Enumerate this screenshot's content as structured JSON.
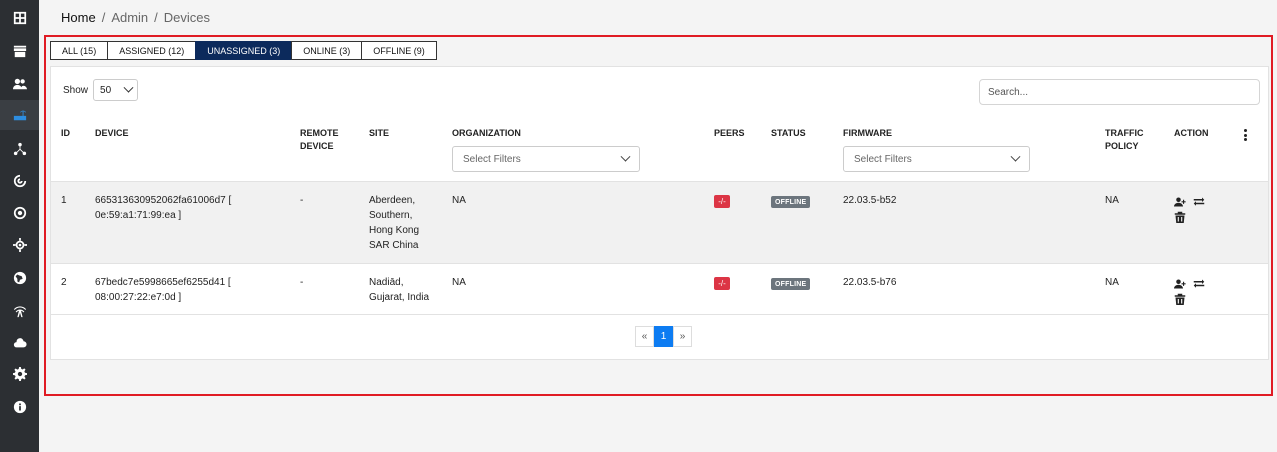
{
  "sidebar": {
    "items": [
      {
        "icon": "dashboard-icon"
      },
      {
        "icon": "store-icon"
      },
      {
        "icon": "users-icon"
      },
      {
        "icon": "router-icon",
        "active": true
      },
      {
        "icon": "network-icon"
      },
      {
        "icon": "radar-icon"
      },
      {
        "icon": "target-icon"
      },
      {
        "icon": "crosshair-icon"
      },
      {
        "icon": "globe-icon"
      },
      {
        "icon": "antenna-icon"
      },
      {
        "icon": "cloud-icon"
      },
      {
        "icon": "gear-icon"
      },
      {
        "icon": "info-icon"
      }
    ]
  },
  "breadcrumb": {
    "home": "Home",
    "sep1": "/",
    "admin": "Admin",
    "sep2": "/",
    "devices": "Devices"
  },
  "tabs": [
    {
      "label": "ALL (15)"
    },
    {
      "label": "ASSIGNED (12)"
    },
    {
      "label": "UNASSIGNED (3)",
      "active": true
    },
    {
      "label": "ONLINE (3)"
    },
    {
      "label": "OFFLINE (9)"
    }
  ],
  "show": {
    "label": "Show",
    "value": "50"
  },
  "search": {
    "placeholder": "Search..."
  },
  "columns": {
    "id": "ID",
    "device": "DEVICE",
    "remote_device_1": "REMOTE",
    "remote_device_2": "DEVICE",
    "site": "SITE",
    "organization": "ORGANIZATION",
    "peers": "PEERS",
    "status": "STATUS",
    "firmware": "FIRMWARE",
    "traffic_policy_1": "TRAFFIC",
    "traffic_policy_2": "POLICY",
    "action": "ACTION"
  },
  "filters": {
    "organization_placeholder": "Select Filters",
    "firmware_placeholder": "Select Filters"
  },
  "rows": [
    {
      "id": "1",
      "device_line1": "665313630952062fa61006d7 [",
      "device_line2": "0e:59:a1:71:99:ea ]",
      "remote": "-",
      "site_lines": [
        "Aberdeen,",
        "Southern,",
        "Hong Kong",
        "SAR China"
      ],
      "organization": "NA",
      "peers": "-/-",
      "status": "OFFLINE",
      "firmware": "22.03.5-b52",
      "traffic_policy": "NA"
    },
    {
      "id": "2",
      "device_line1": "67bedc7e5998665ef6255d41 [",
      "device_line2": "08:00:27:22:e7:0d ]",
      "remote": "-",
      "site_lines": [
        "Nadiād,",
        "Gujarat, India"
      ],
      "organization": "NA",
      "peers": "-/-",
      "status": "OFFLINE",
      "firmware": "22.03.5-b76",
      "traffic_policy": "NA"
    }
  ],
  "pagination": {
    "prev": "«",
    "current": "1",
    "next": "»"
  },
  "colors": {
    "accent": "#0c2a5c",
    "highlight": "#e01b24",
    "peer_badge": "#dc3545",
    "status_badge": "#6c757d",
    "pager_active": "#0d7cf2"
  }
}
